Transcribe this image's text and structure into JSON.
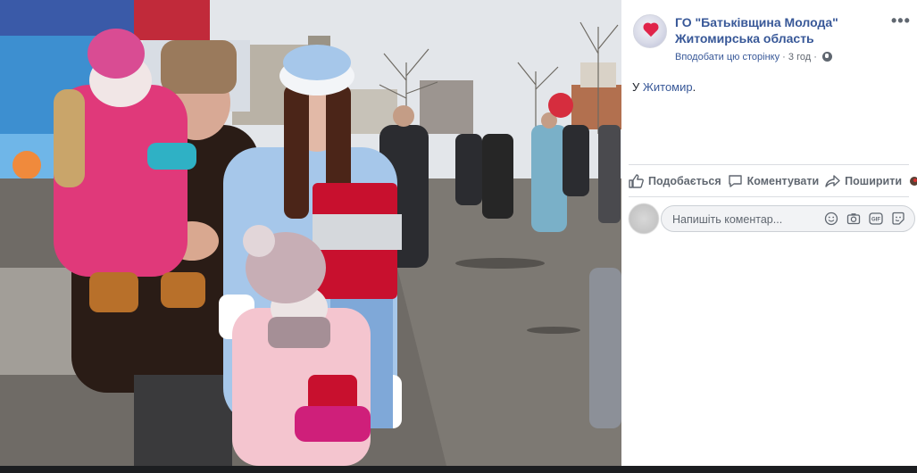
{
  "post": {
    "page_name_line1": "ГО \"Батьківщина Молода\"",
    "page_name_line2": "Житомирська область",
    "follow_label": "Вподобати цю сторінку",
    "separator": "·",
    "time": "3 год",
    "separator2": "·",
    "text_prefix": "У ",
    "text_link": "Житомир",
    "text_suffix": ".",
    "more_label": "•••"
  },
  "actions": {
    "like": "Подобається",
    "comment": "Коментувати",
    "share": "Поширити"
  },
  "comment_box": {
    "placeholder": "Напишіть коментар..."
  },
  "icons": {
    "globe": "globe-icon",
    "like": "thumbs-up-icon",
    "comment": "speech-bubble-icon",
    "share": "share-arrow-icon",
    "emoji": "smiley-icon",
    "camera": "camera-icon",
    "gif": "gif-icon",
    "sticker": "sticker-icon",
    "more": "more-dots-icon"
  },
  "colors": {
    "link": "#385898",
    "text": "#1d2129",
    "muted": "#606770"
  }
}
